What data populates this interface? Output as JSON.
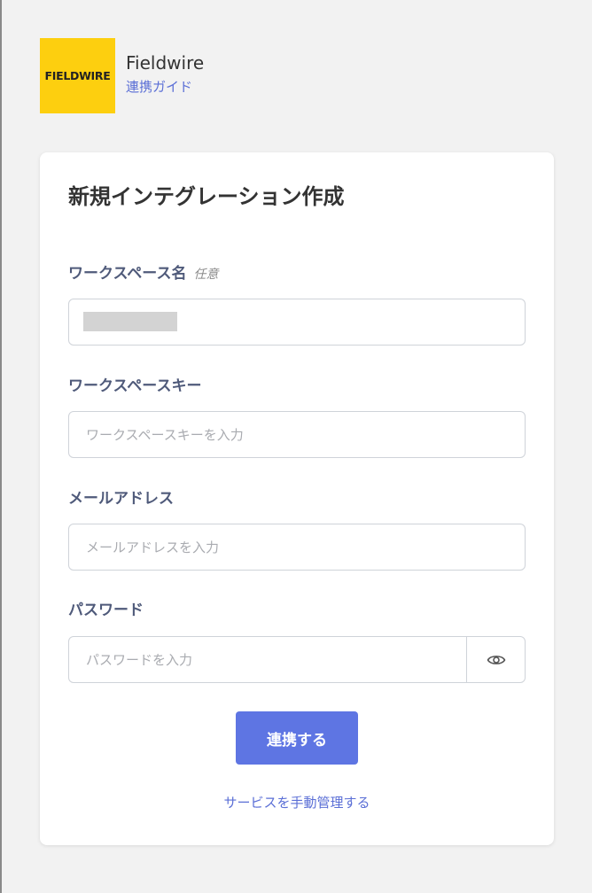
{
  "app": {
    "logo_text": "FIELDWIRE",
    "name": "Fieldwire",
    "guide_link": "連携ガイド"
  },
  "form": {
    "title": "新規インテグレーション作成",
    "workspace_name": {
      "label": "ワークスペース名",
      "optional": "任意",
      "value": ""
    },
    "workspace_key": {
      "label": "ワークスペースキー",
      "placeholder": "ワークスペースキーを入力"
    },
    "email": {
      "label": "メールアドレス",
      "placeholder": "メールアドレスを入力"
    },
    "password": {
      "label": "パスワード",
      "placeholder": "パスワードを入力",
      "toggle_icon": "eye-icon"
    },
    "submit_label": "連携する",
    "manual_link": "サービスを手動管理する"
  },
  "colors": {
    "background": "#f2f2f2",
    "logo": "#fdcf0f",
    "accent": "#5e75e3",
    "link": "#5b6fd6",
    "label": "#4f5a7a"
  }
}
